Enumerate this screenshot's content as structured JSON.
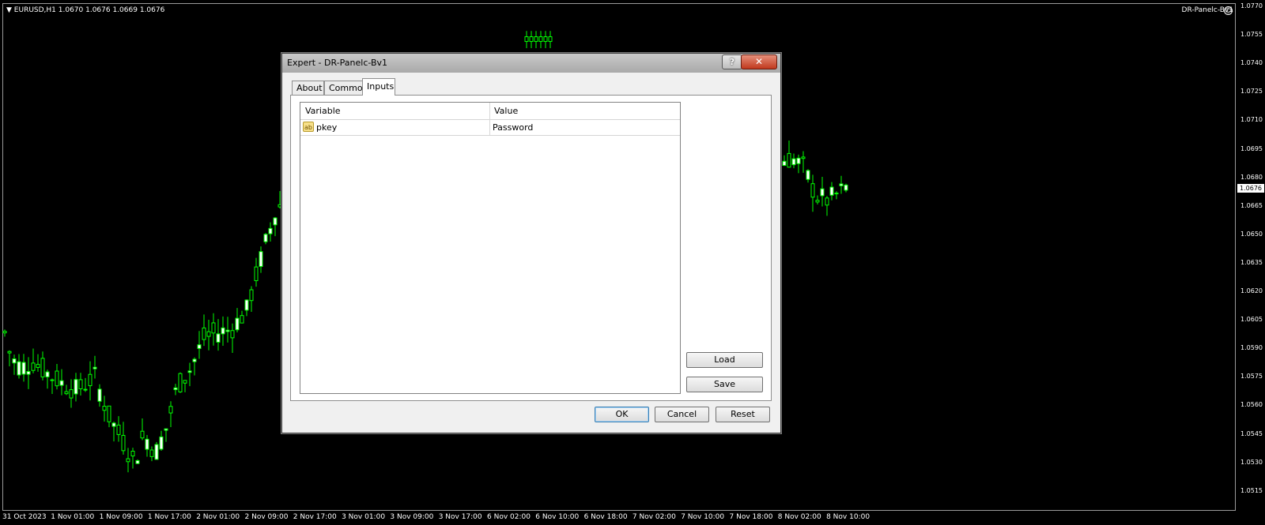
{
  "chart": {
    "symbol_info": "EURUSD,H1  1.0670 1.0676 1.0669 1.0676",
    "ea_name": "DR-Panelc-Bv1",
    "current_price": "1.0676",
    "price_ticks": [
      "1.0770",
      "1.0755",
      "1.0740",
      "1.0725",
      "1.0710",
      "1.0695",
      "1.0680",
      "1.0665",
      "1.0650",
      "1.0635",
      "1.0620",
      "1.0605",
      "1.0590",
      "1.0575",
      "1.0560",
      "1.0545",
      "1.0530",
      "1.0515"
    ],
    "time_ticks": [
      "31 Oct 2023",
      "1 Nov 01:00",
      "1 Nov 09:00",
      "1 Nov 17:00",
      "2 Nov 01:00",
      "2 Nov 09:00",
      "2 Nov 17:00",
      "3 Nov 01:00",
      "3 Nov 09:00",
      "3 Nov 17:00",
      "6 Nov 02:00",
      "6 Nov 10:00",
      "6 Nov 18:00",
      "7 Nov 02:00",
      "7 Nov 10:00",
      "7 Nov 18:00",
      "8 Nov 02:00",
      "8 Nov 10:00"
    ],
    "colors": {
      "bull": "#00ff00",
      "bear_body": "#ffffff",
      "background": "#000000"
    }
  },
  "dialog": {
    "title": "Expert - DR-Panelc-Bv1",
    "help_label": "?",
    "close_label": "✕",
    "tabs": [
      {
        "label": "About",
        "active": false
      },
      {
        "label": "Common",
        "active": false
      },
      {
        "label": "Inputs",
        "active": true
      }
    ],
    "inputs_table": {
      "columns": [
        "Variable",
        "Value"
      ],
      "rows": [
        {
          "icon": "ab-string-icon",
          "icon_text": "ab",
          "variable": "pkey",
          "value": "Password"
        }
      ]
    },
    "side_buttons": {
      "load": "Load",
      "save": "Save"
    },
    "footer_buttons": {
      "ok": "OK",
      "cancel": "Cancel",
      "reset": "Reset"
    }
  }
}
